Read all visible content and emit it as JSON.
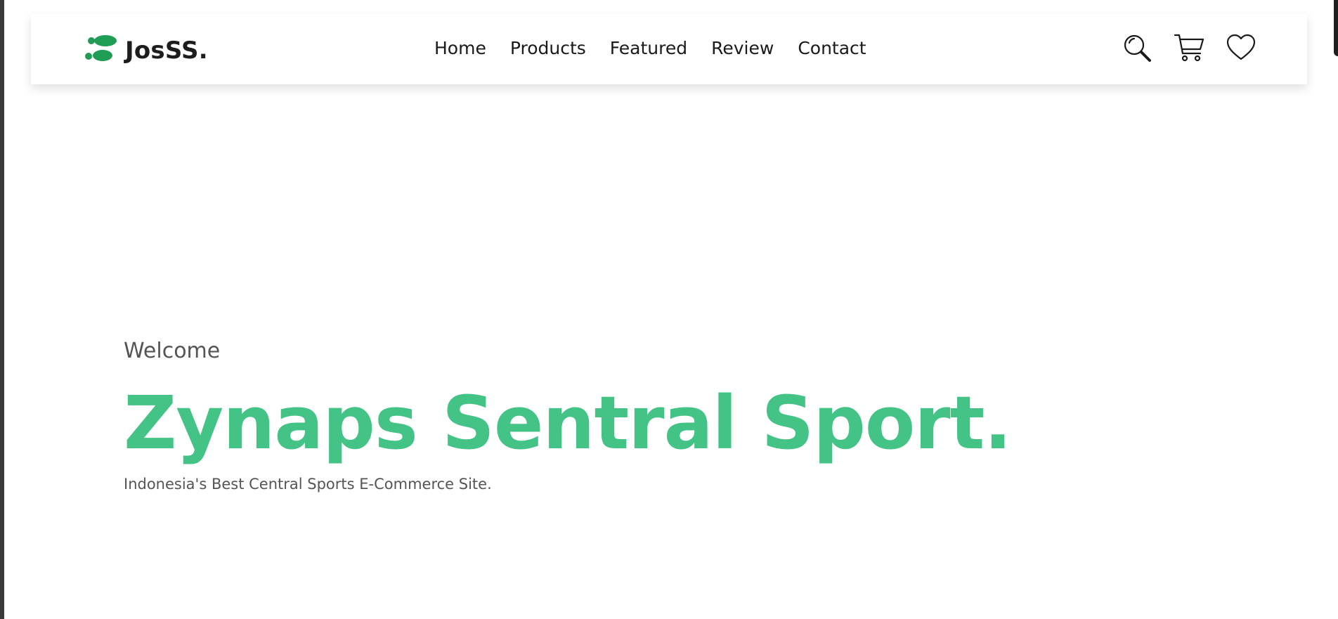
{
  "brand": {
    "name": "JosSS.",
    "logo_icon": "footprints-icon",
    "accent_color": "#1f9d55"
  },
  "nav": {
    "links": [
      "Home",
      "Products",
      "Featured",
      "Review",
      "Contact"
    ],
    "icons": [
      "search-icon",
      "cart-icon",
      "heart-icon"
    ]
  },
  "hero": {
    "welcome": "Welcome",
    "title": "Zynaps Sentral Sport.",
    "subtitle": "Indonesia's Best Central Sports E-Commerce Site.",
    "title_color": "#44c386"
  }
}
